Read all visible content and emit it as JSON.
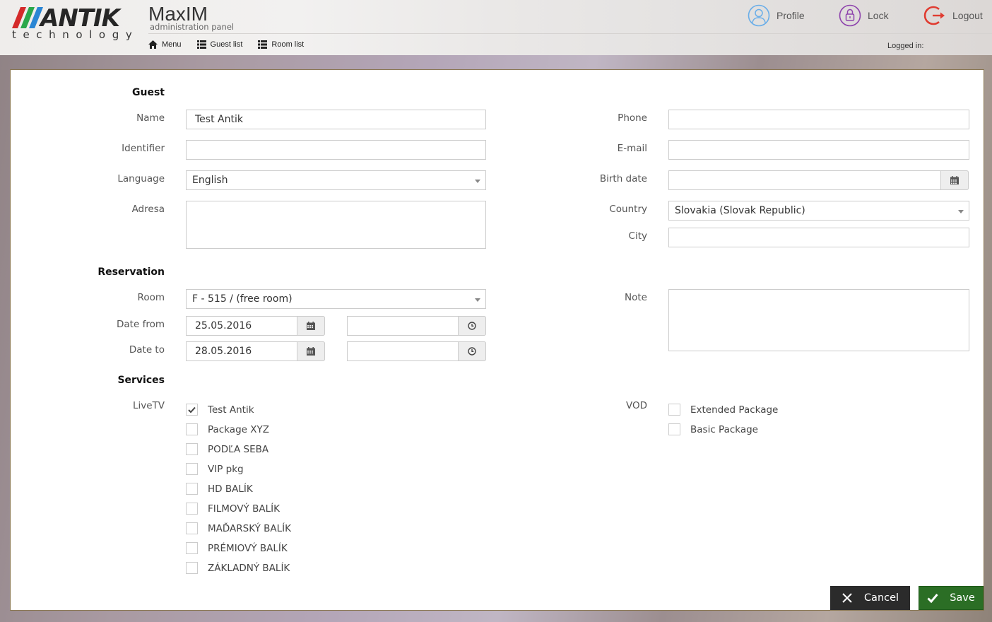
{
  "brand": {
    "logo_word": "ANTIK",
    "logo_sub": "technology",
    "app_title": "MaxIM",
    "app_subtitle": "administration panel",
    "stripe_colors": [
      "#d42a2a",
      "#2aa84a",
      "#2a86d4"
    ]
  },
  "nav": {
    "items": [
      {
        "label": "Menu",
        "icon": "home-icon"
      },
      {
        "label": "Guest list",
        "icon": "list-icon"
      },
      {
        "label": "Room list",
        "icon": "list-icon"
      }
    ]
  },
  "top_actions": {
    "profile": {
      "label": "Profile",
      "icon": "user-icon",
      "color": "#6aaee8"
    },
    "lock": {
      "label": "Lock",
      "icon": "lock-icon",
      "color": "#8e44ad"
    },
    "logout": {
      "label": "Logout",
      "icon": "logout-icon",
      "color": "#e03c31"
    }
  },
  "session": {
    "logged_in_label": "Logged in:"
  },
  "guest": {
    "section_title": "Guest",
    "name": {
      "label": "Name",
      "value": "Test Antik"
    },
    "identifier": {
      "label": "Identifier",
      "value": ""
    },
    "language": {
      "label": "Language",
      "value": "English"
    },
    "address": {
      "label": "Adresa",
      "value": ""
    },
    "phone": {
      "label": "Phone",
      "value": ""
    },
    "email": {
      "label": "E-mail",
      "value": ""
    },
    "birth_date": {
      "label": "Birth date",
      "value": ""
    },
    "country": {
      "label": "Country",
      "value": "Slovakia (Slovak Republic)"
    },
    "city": {
      "label": "City",
      "value": ""
    }
  },
  "reservation": {
    "section_title": "Reservation",
    "room": {
      "label": "Room",
      "value": "F - 515 / (free room)"
    },
    "date_from": {
      "label": "Date from",
      "date": "25.05.2016",
      "time": ""
    },
    "date_to": {
      "label": "Date to",
      "date": "28.05.2016",
      "time": ""
    },
    "note": {
      "label": "Note",
      "value": ""
    }
  },
  "services": {
    "section_title": "Services",
    "livetv": {
      "label": "LiveTV",
      "packages": [
        {
          "name": "Test Antik",
          "checked": true
        },
        {
          "name": "Package XYZ",
          "checked": false
        },
        {
          "name": "PODĽA SEBA",
          "checked": false
        },
        {
          "name": "VIP pkg",
          "checked": false
        },
        {
          "name": "HD BALÍK",
          "checked": false
        },
        {
          "name": "FILMOVÝ BALÍK",
          "checked": false
        },
        {
          "name": "MAĎARSKÝ BALÍK",
          "checked": false
        },
        {
          "name": "PRÉMIOVÝ BALÍK",
          "checked": false
        },
        {
          "name": "ZÁKLADNÝ BALÍK",
          "checked": false
        }
      ]
    },
    "vod": {
      "label": "VOD",
      "packages": [
        {
          "name": "Extended Package",
          "checked": false
        },
        {
          "name": "Basic Package",
          "checked": false
        }
      ]
    }
  },
  "actions": {
    "cancel_label": "Cancel",
    "save_label": "Save",
    "cancel_color": "#2b2b2b",
    "save_color": "#2b6e25"
  }
}
